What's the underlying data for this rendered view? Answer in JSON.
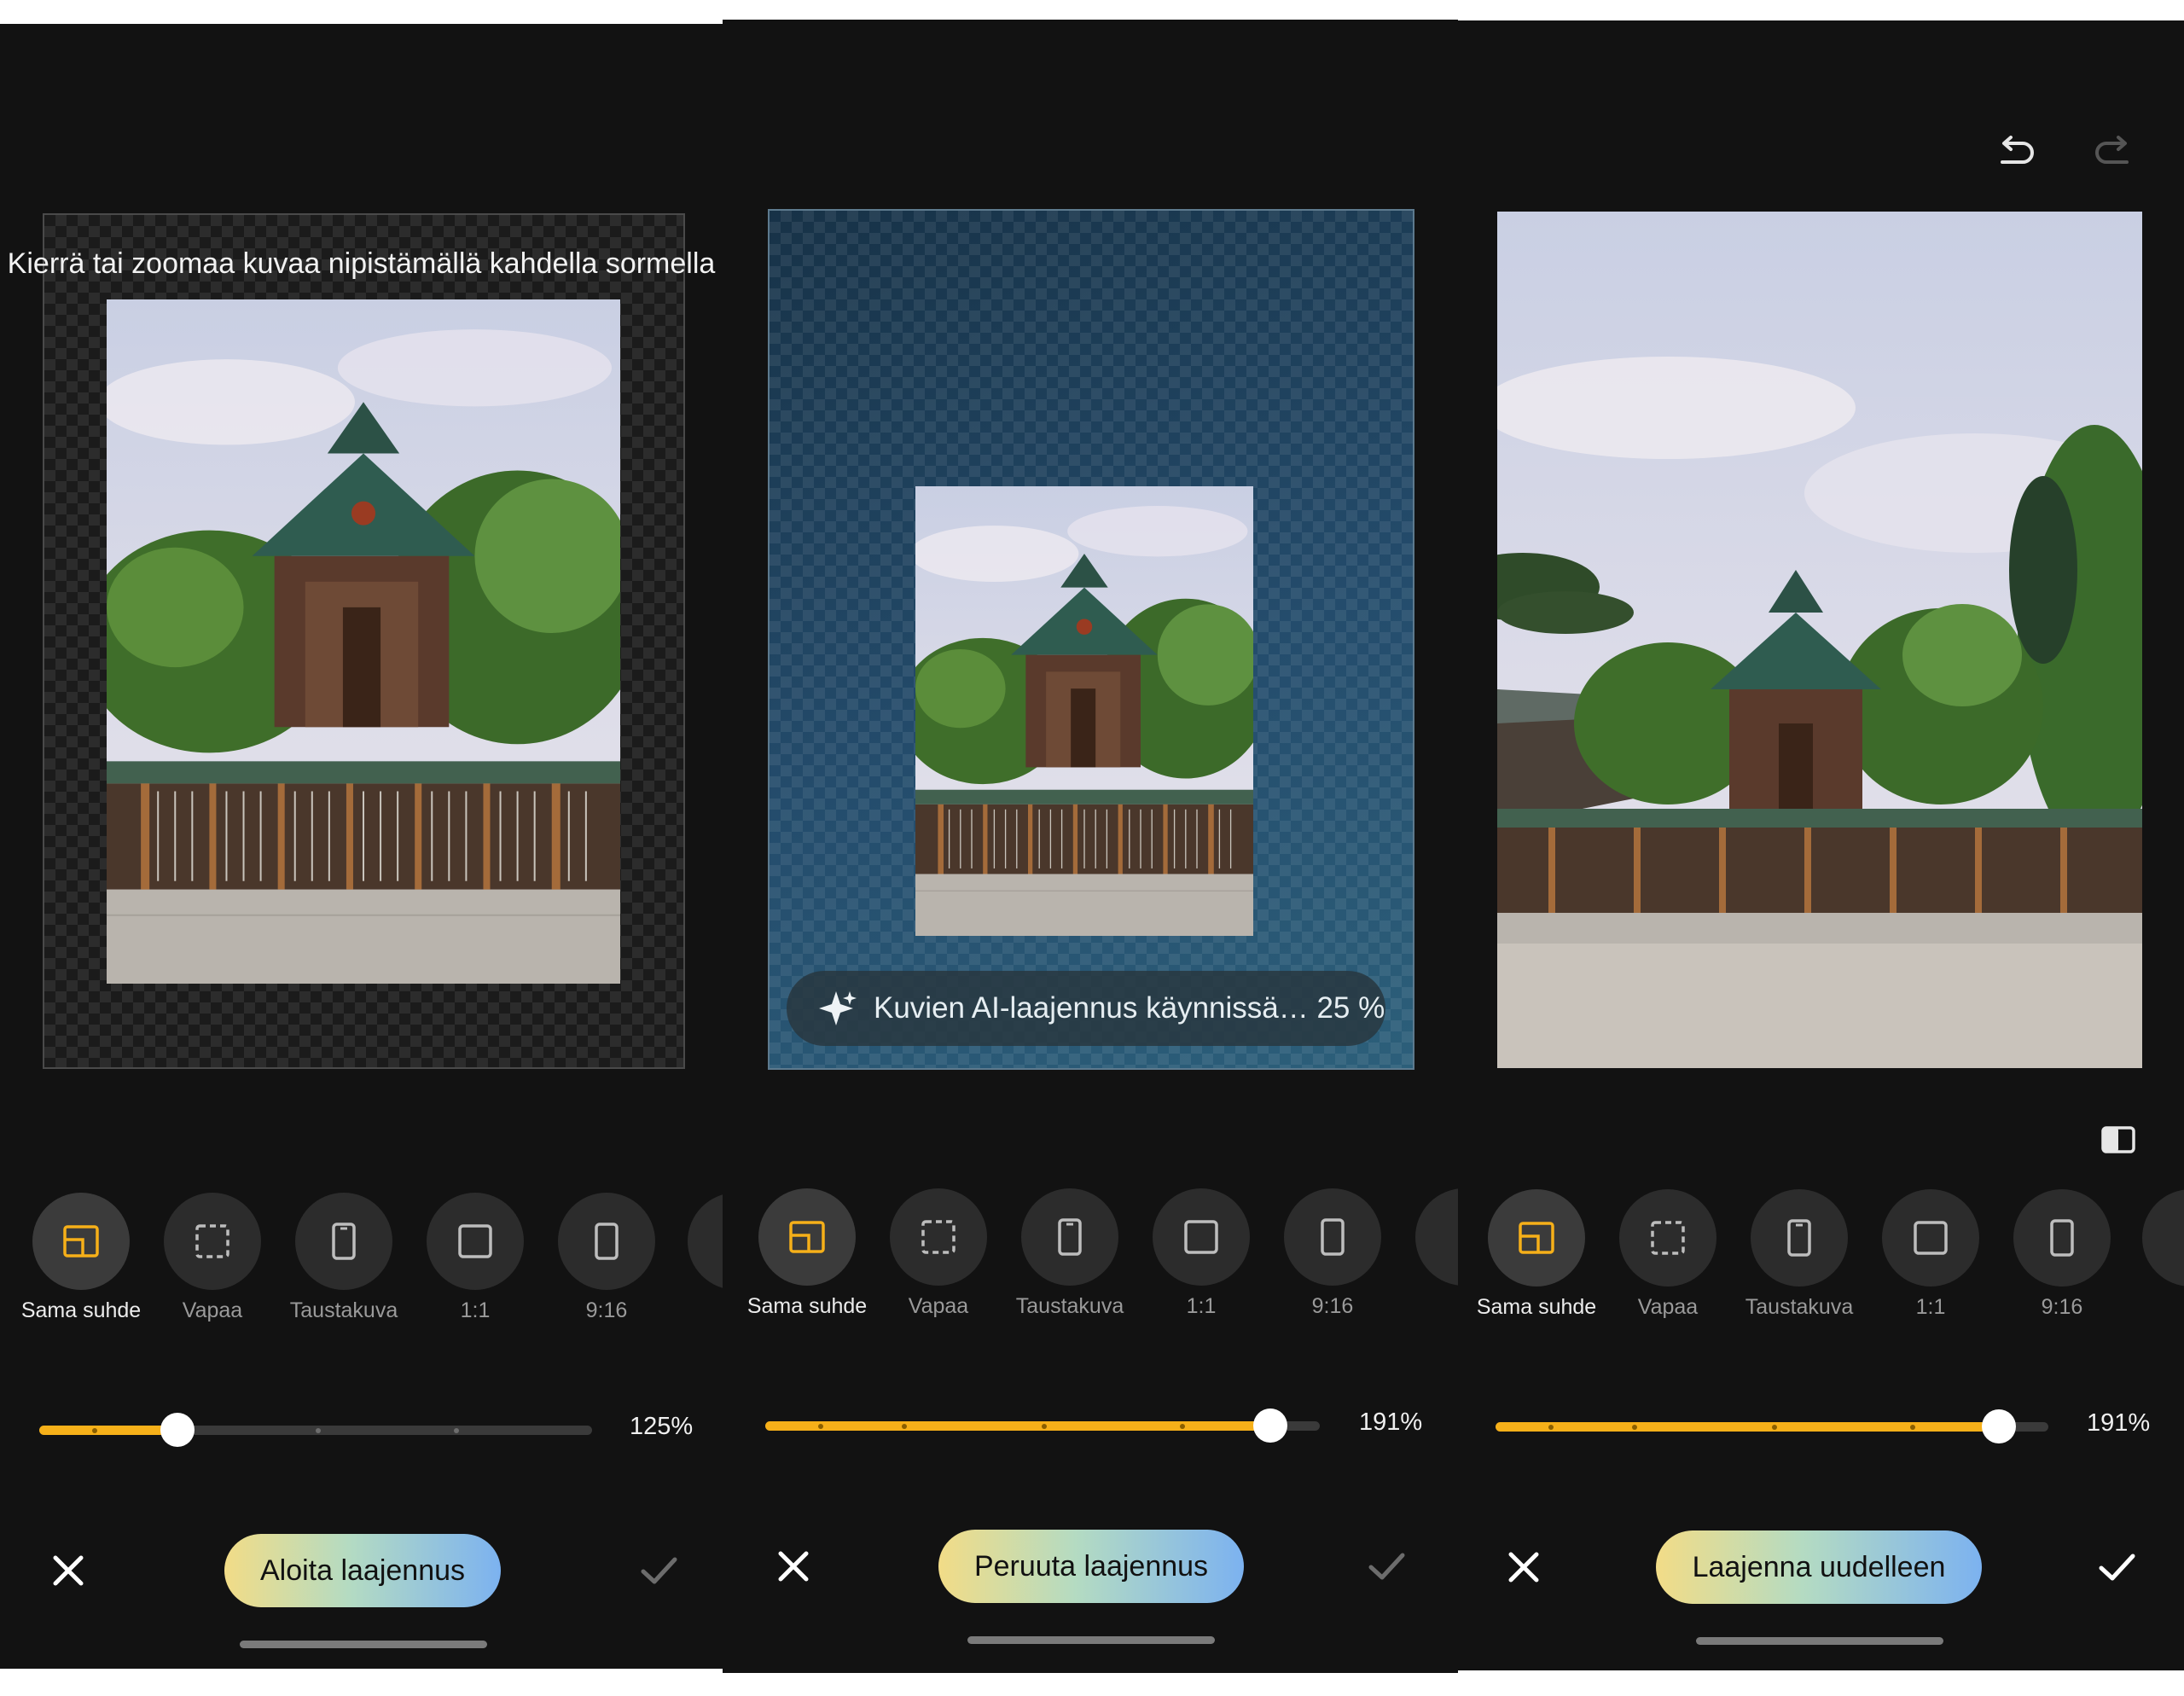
{
  "screens": [
    {
      "hint": "Kierrä tai zoomaa kuvaa nipistämällä kahdella sormella",
      "options": [
        "Sama suhde",
        "Vapaa",
        "Taustakuva",
        "1:1",
        "9:16"
      ],
      "active_option": "Sama suhde",
      "zoom": {
        "label": "125%",
        "level": 0.25
      },
      "action_label": "Aloita laajennus",
      "confirm_enabled": false
    },
    {
      "progress_text": "Kuvien AI-laajennus käynnissä… 25 %",
      "progress_icon": "ai-sparkle-icon",
      "options": [
        "Sama suhde",
        "Vapaa",
        "Taustakuva",
        "1:1",
        "9:16"
      ],
      "active_option": "Sama suhde",
      "zoom": {
        "label": "191%",
        "level": 0.91
      },
      "action_label": "Peruuta laajennus",
      "confirm_enabled": false
    },
    {
      "options": [
        "Sama suhde",
        "Vapaa",
        "Taustakuva",
        "1:1",
        "9:16"
      ],
      "active_option": "Sama suhde",
      "zoom": {
        "label": "191%",
        "level": 0.91
      },
      "action_label": "Laajenna uudelleen",
      "confirm_enabled": true,
      "toolbar_icons": [
        "undo-icon",
        "redo-icon",
        "compare-icon"
      ]
    }
  ],
  "colors": {
    "accent": "#f6b019",
    "background": "#121212",
    "pill_start": "#f2dc87",
    "pill_end": "#7cb2f0"
  }
}
